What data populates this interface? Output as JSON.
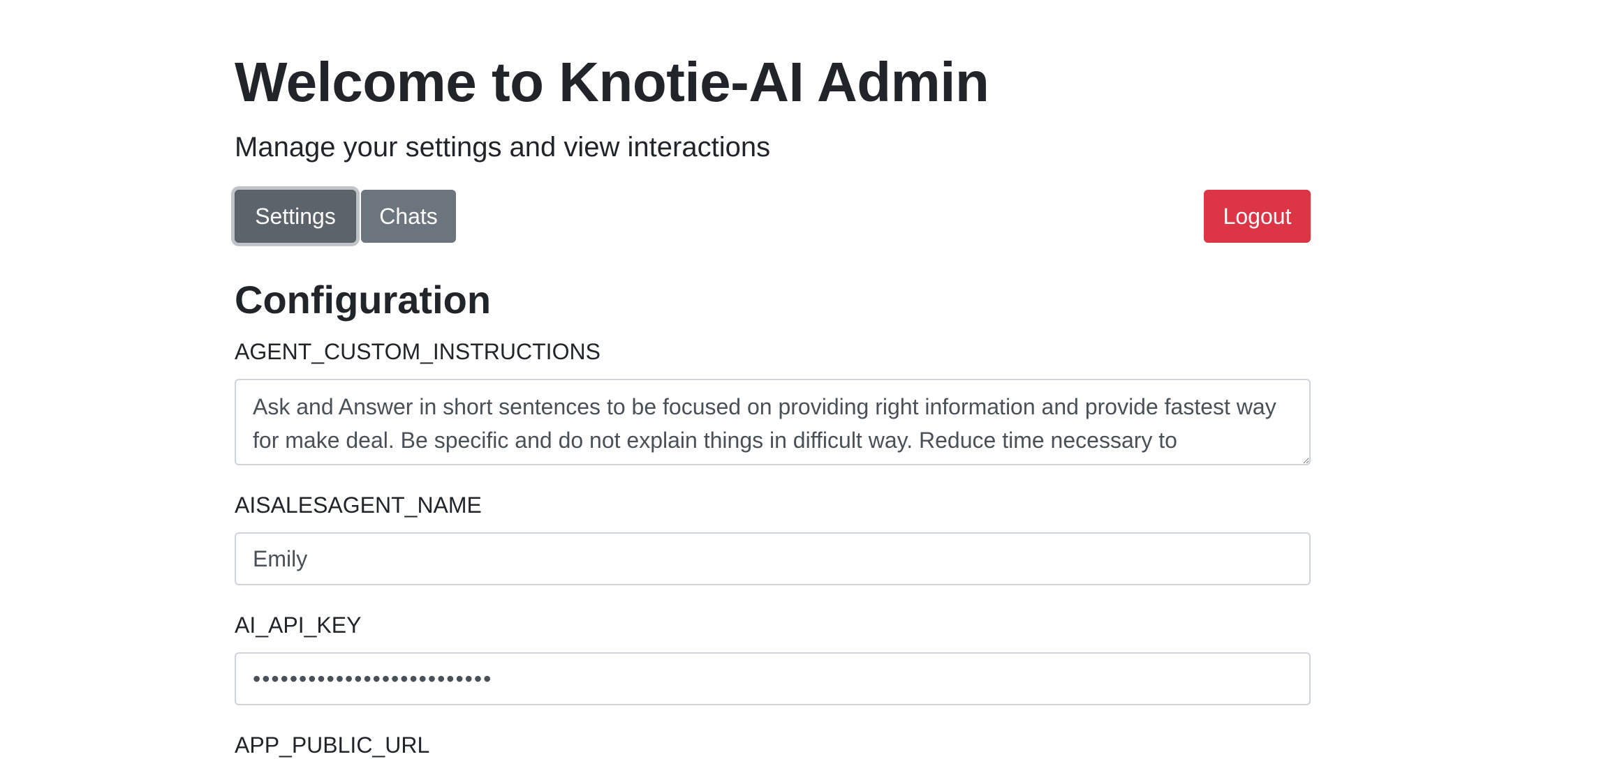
{
  "header": {
    "title": "Welcome to Knotie-AI Admin",
    "subtitle": "Manage your settings and view interactions"
  },
  "nav": {
    "settings_label": "Settings",
    "chats_label": "Chats",
    "logout_label": "Logout"
  },
  "config": {
    "section_title": "Configuration",
    "fields": [
      {
        "label": "AGENT_CUSTOM_INSTRUCTIONS",
        "value": "Ask and Answer in short sentences to be focused on providing right information and provide fastest way for make deal. Be specific and do not explain things in difficult way. Reduce time necessary to"
      },
      {
        "label": "AISALESAGENT_NAME",
        "value": "Emily"
      },
      {
        "label": "AI_API_KEY",
        "value": "••••••••••••••••••••••••••"
      },
      {
        "label": "APP_PUBLIC_URL"
      }
    ]
  },
  "colors": {
    "settings_button": "#5c636a",
    "chats_button": "#6c757d",
    "logout_button": "#dc3545",
    "input_border": "#ced4da"
  }
}
